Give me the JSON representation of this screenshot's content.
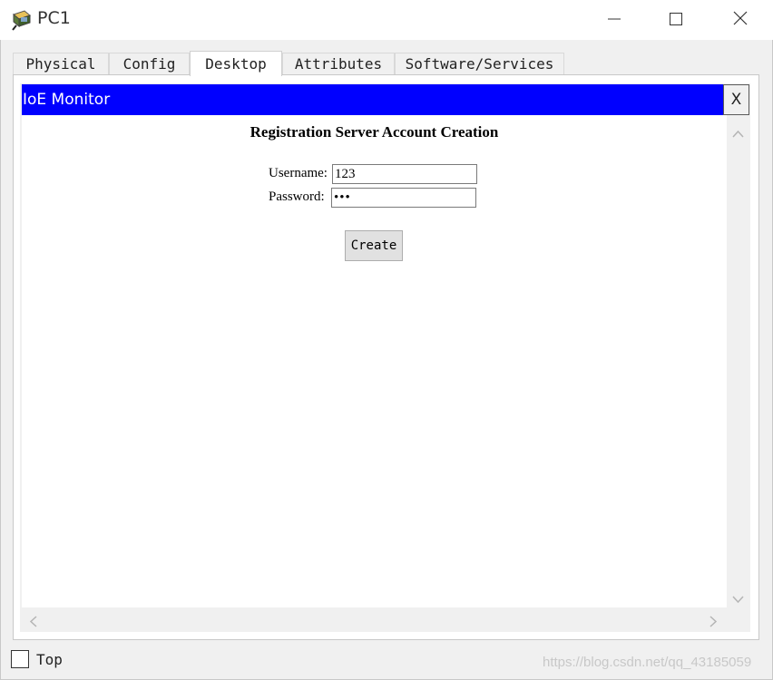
{
  "window": {
    "title": "PC1",
    "icon": "pc-icon"
  },
  "tabs": [
    {
      "label": "Physical",
      "active": false
    },
    {
      "label": "Config",
      "active": false
    },
    {
      "label": "Desktop",
      "active": true
    },
    {
      "label": "Attributes",
      "active": false
    },
    {
      "label": "Software/Services",
      "active": false
    }
  ],
  "ioe_monitor": {
    "header": "IoE Monitor",
    "close_label": "X",
    "page_title": "Registration Server Account Creation",
    "username_label": "Username:",
    "username_value": "123",
    "password_label": "Password:",
    "password_value": "•••",
    "create_button": "Create"
  },
  "footer": {
    "top_label": "Top",
    "top_checked": false,
    "watermark": "https://blog.csdn.net/qq_43185059"
  },
  "colors": {
    "header_bg": "#0000ff",
    "header_text": "#ffffff",
    "window_bg": "#f0f0f0"
  }
}
